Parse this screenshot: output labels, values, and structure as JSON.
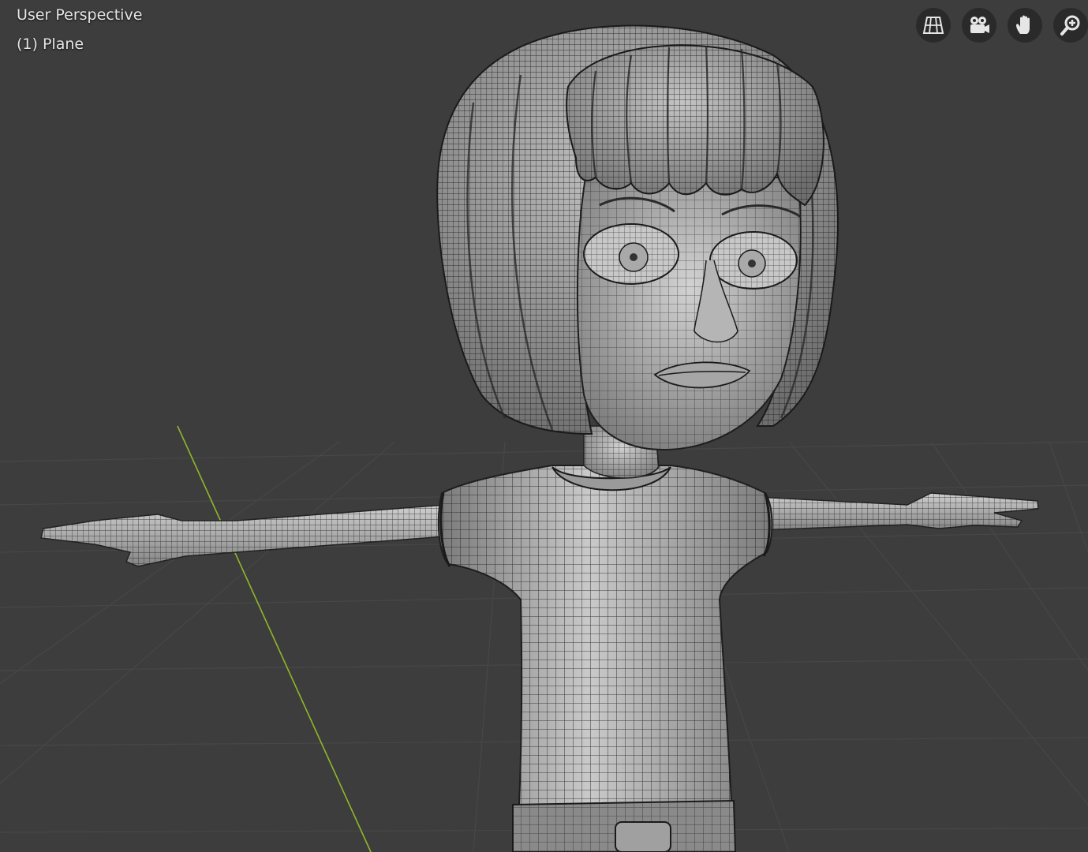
{
  "viewport": {
    "title": "User Perspective",
    "object_label": "(1) Plane"
  },
  "nav_gizmo": [
    {
      "name": "toggle-camera-ortho",
      "icon": "perspective-grid-icon"
    },
    {
      "name": "camera-view",
      "icon": "camera-icon"
    },
    {
      "name": "pan-view",
      "icon": "hand-icon"
    },
    {
      "name": "zoom-view",
      "icon": "zoom-icon"
    }
  ],
  "colors": {
    "background": "#3d3d3d",
    "grid": "#4a4a4a",
    "y_axis": "#8fb82a",
    "mesh": "#9a9a9a",
    "wire": "#1a1a1a"
  }
}
